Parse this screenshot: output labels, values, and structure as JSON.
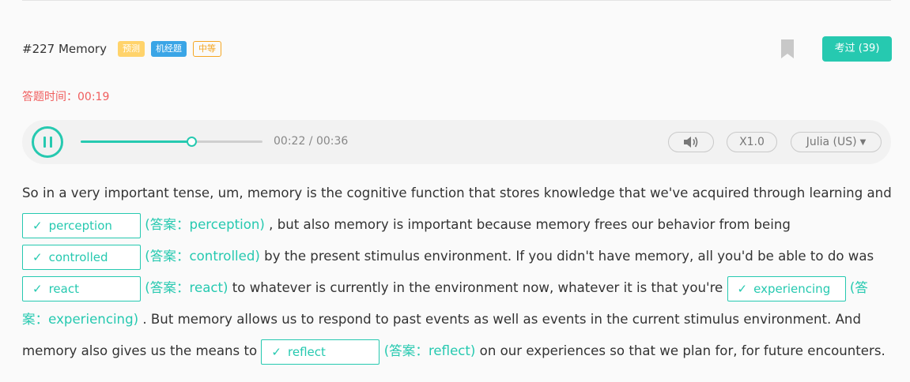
{
  "header": {
    "title": "#227 Memory",
    "tags": [
      "预测",
      "机经题",
      "中等"
    ],
    "exam_button": "考过 (39)"
  },
  "timer": {
    "label": "答题时间：",
    "value": "00:19"
  },
  "player": {
    "time": "00:22 / 00:36",
    "progress": 0.61,
    "speed": "X1.0",
    "voice": "Julia (US)",
    "volume_icon": "speaker-icon"
  },
  "passage": {
    "check": "✓",
    "t0": "So in a very important tense, um, memory is the cognitive function that stores knowledge that we've acquired through learning and ",
    "b1": "perception",
    "a1": "(答案：perception)",
    "t1": " , but also memory is important because memory frees our behavior from being ",
    "b2": "controlled",
    "a2": "(答案：controlled)",
    "t2": " by the present stimulus environment. If you didn't have memory, all you'd be able to do was ",
    "b3": "react",
    "a3": "(答案：react)",
    "t3": " to whatever is currently in the environment now, whatever it is that you're ",
    "b4": "experiencing",
    "a4": "(答案：experiencing)",
    "t4": " . But memory allows us to respond to past events as well as events in the current stimulus environment. And memory also gives us the means to ",
    "b5": "reflect",
    "a5": "(答案：reflect)",
    "t5": " on our experiences so that we plan for, for future encounters."
  },
  "colors": {
    "accent": "#26c9b0",
    "timer": "#f05d5d",
    "tag_yellow": "#ffd36b",
    "tag_blue": "#3aa5e6",
    "tag_orange": "#f5a623"
  }
}
